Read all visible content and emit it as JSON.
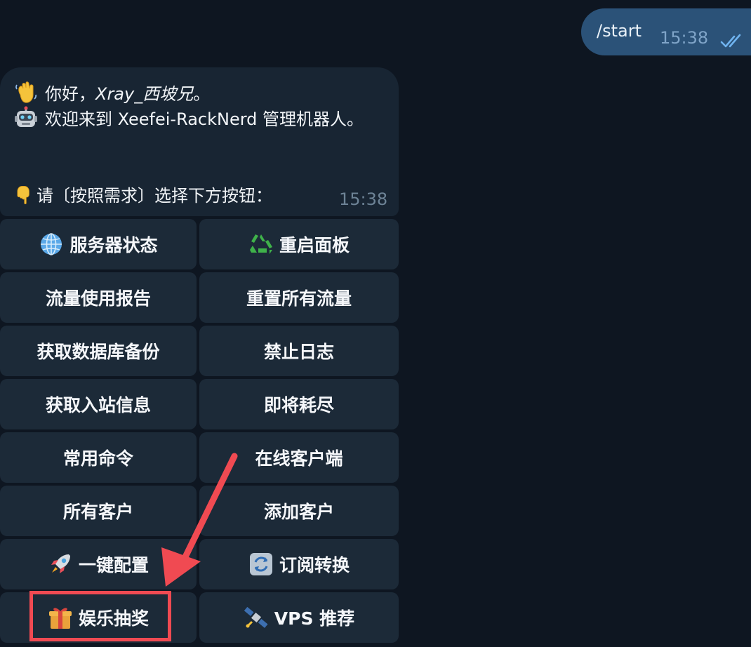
{
  "outgoing": {
    "text": "/start",
    "time": "15:38",
    "status_icon": "double-check-icon"
  },
  "incoming": {
    "greeting_prefix": "你好，",
    "greeting_name": "Xray_西坡兄",
    "greeting_suffix": "。",
    "welcome": "欢迎来到 Xeefei-RackNerd 管理机器人。",
    "prompt": "请〔按照需求〕选择下方按钮：",
    "time": "15:38"
  },
  "keyboard": {
    "buttons": [
      {
        "label": "服务器状态",
        "icon": "globe-icon"
      },
      {
        "label": "重启面板",
        "icon": "recycle-icon"
      },
      {
        "label": "流量使用报告",
        "icon": ""
      },
      {
        "label": "重置所有流量",
        "icon": ""
      },
      {
        "label": "获取数据库备份",
        "icon": ""
      },
      {
        "label": "禁止日志",
        "icon": ""
      },
      {
        "label": "获取入站信息",
        "icon": ""
      },
      {
        "label": "即将耗尽",
        "icon": ""
      },
      {
        "label": "常用命令",
        "icon": ""
      },
      {
        "label": "在线客户端",
        "icon": ""
      },
      {
        "label": "所有客户",
        "icon": ""
      },
      {
        "label": "添加客户",
        "icon": ""
      },
      {
        "label": "一键配置",
        "icon": "rocket-icon"
      },
      {
        "label": "订阅转换",
        "icon": "refresh-icon"
      },
      {
        "label": "娱乐抽奖",
        "icon": "gift-icon"
      },
      {
        "label": "VPS 推荐",
        "icon": "satellite-icon"
      }
    ]
  },
  "colors": {
    "background": "#0e1621",
    "outgoing_bubble": "#2b5278",
    "incoming_bubble": "#182533",
    "button": "#1c2a38",
    "annotation": "#f04a52"
  }
}
